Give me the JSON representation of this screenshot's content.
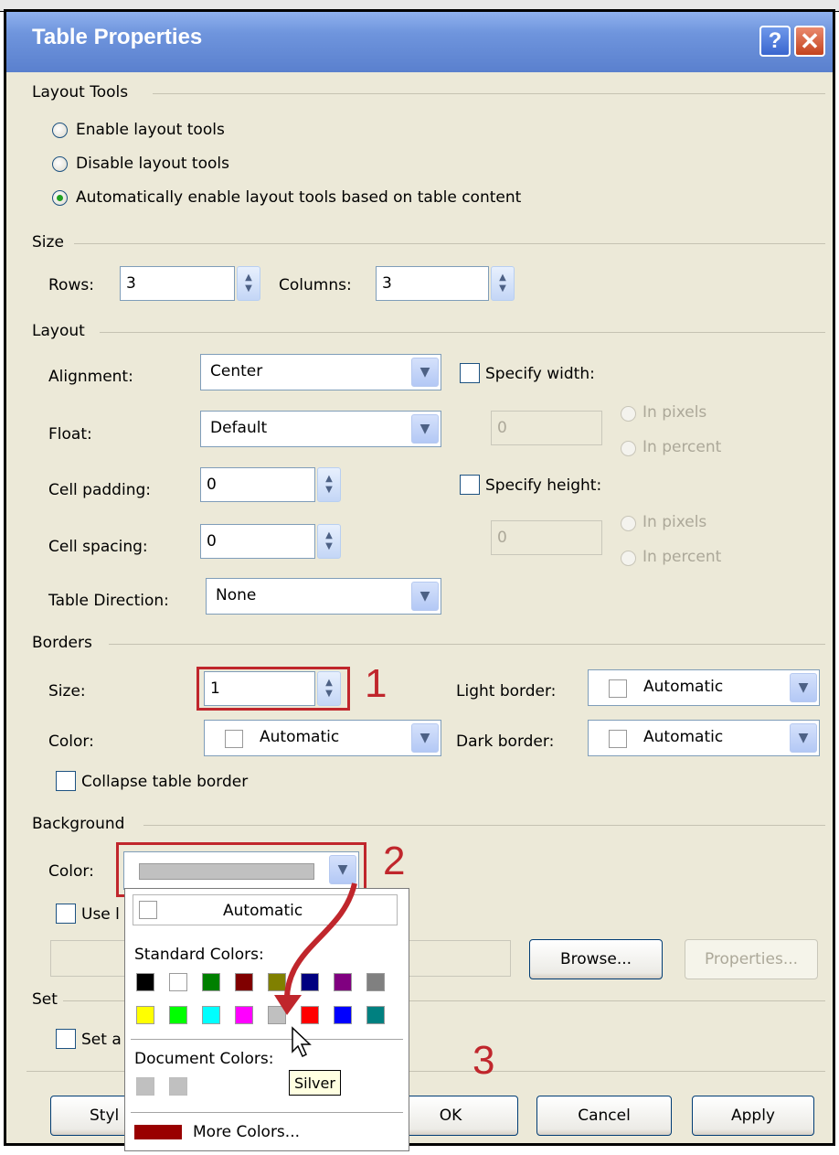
{
  "dialog": {
    "title": "Table Properties",
    "help_label": "?",
    "close_label": "✕"
  },
  "layout_tools": {
    "heading": "Layout Tools",
    "options": [
      {
        "label": "Enable layout tools",
        "selected": false
      },
      {
        "label": "Disable layout tools",
        "selected": false
      },
      {
        "label": "Automatically enable layout tools based on table content",
        "selected": true
      }
    ]
  },
  "size": {
    "heading": "Size",
    "rows_label": "Rows:",
    "rows_value": "3",
    "columns_label": "Columns:",
    "columns_value": "3"
  },
  "layout": {
    "heading": "Layout",
    "alignment_label": "Alignment:",
    "alignment_value": "Center",
    "float_label": "Float:",
    "float_value": "Default",
    "cell_padding_label": "Cell padding:",
    "cell_padding_value": "0",
    "cell_spacing_label": "Cell spacing:",
    "cell_spacing_value": "0",
    "direction_label": "Table Direction:",
    "direction_value": "None",
    "specify_width_label": "Specify width:",
    "width_value": "0",
    "specify_height_label": "Specify height:",
    "height_value": "0",
    "in_pixels": "In pixels",
    "in_percent": "In percent"
  },
  "borders": {
    "heading": "Borders",
    "size_label": "Size:",
    "size_value": "1",
    "color_label": "Color:",
    "color_value": "Automatic",
    "light_border_label": "Light border:",
    "light_border_value": "Automatic",
    "dark_border_label": "Dark border:",
    "dark_border_value": "Automatic",
    "collapse_label": "Collapse table border"
  },
  "background": {
    "heading": "Background",
    "color_label": "Color:",
    "color_value": "#c0c0c0",
    "use_image_label": "Use l",
    "browse_label": "Browse...",
    "properties_label": "Properties..."
  },
  "set": {
    "heading": "Set",
    "set_default_label": "Set a"
  },
  "footer": {
    "style_label": "Styl",
    "ok_label": "OK",
    "cancel_label": "Cancel",
    "apply_label": "Apply"
  },
  "color_picker": {
    "automatic_label": "Automatic",
    "standard_colors_label": "Standard Colors:",
    "standard_colors": [
      "#000000",
      "#ffffff",
      "#008000",
      "#800000",
      "#808000",
      "#000080",
      "#800080",
      "#808080",
      "#ffff00",
      "#00ff00",
      "#00ffff",
      "#ff00ff",
      "#c0c0c0",
      "#ff0000",
      "#0000ff",
      "#008080"
    ],
    "document_colors_label": "Document Colors:",
    "document_colors": [
      "#c0c0c0",
      "#c0c0c0"
    ],
    "more_colors_label": "More Colors...",
    "more_colors_swatch": "#990000",
    "tooltip": "Silver"
  },
  "annotations": {
    "step1": "1",
    "step2": "2",
    "step3": "3",
    "color": "#c0262c"
  }
}
